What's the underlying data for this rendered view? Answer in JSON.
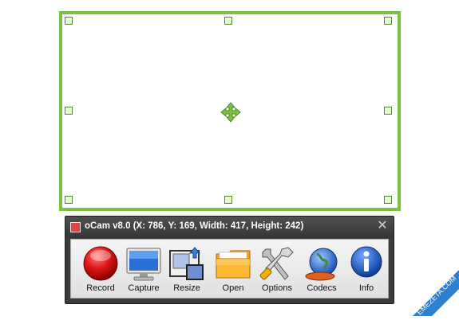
{
  "window": {
    "title": "oCam v8.0 (X: 786, Y: 169, Width: 417, Height: 242)",
    "close_glyph": "✕"
  },
  "toolbar": {
    "buttons": [
      {
        "label": "Record",
        "icon": "record-icon"
      },
      {
        "label": "Capture",
        "icon": "monitor-icon"
      },
      {
        "label": "Resize",
        "icon": "resize-icon"
      },
      {
        "label": "Open",
        "icon": "folder-icon"
      },
      {
        "label": "Options",
        "icon": "tools-icon"
      },
      {
        "label": "Codecs",
        "icon": "globe-icon"
      },
      {
        "label": "Info",
        "icon": "info-icon"
      }
    ]
  },
  "region": {
    "border_color": "#7dc142"
  },
  "watermark": {
    "text": "EMEZETA.COM"
  }
}
